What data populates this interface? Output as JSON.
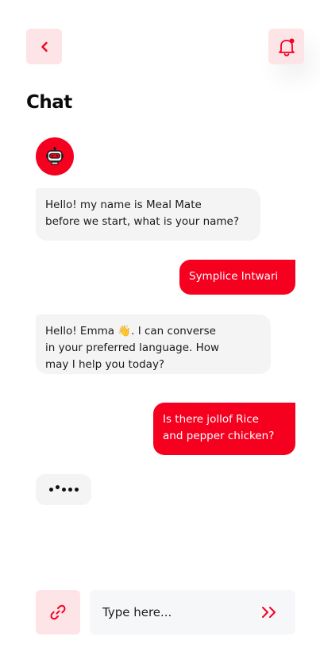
{
  "header": {
    "back_icon": "chevron-left-icon",
    "notification_icon": "bell-icon"
  },
  "page_title": "Chat",
  "bot_avatar_icon": "robot-icon",
  "messages": [
    {
      "sender": "bot",
      "lines": [
        "Hello! my name is Meal Mate",
        "before we start, what is your name?"
      ]
    },
    {
      "sender": "user",
      "lines": [
        "Symplice Intwari"
      ]
    },
    {
      "sender": "bot",
      "lines": [
        "Hello! Emma 👋. I can converse",
        "in your preferred language. How",
        "may I help you today?"
      ]
    },
    {
      "sender": "user",
      "lines": [
        "Is there jollof Rice",
        "and pepper chicken?"
      ]
    }
  ],
  "composer": {
    "placeholder": "Type here...",
    "attach_icon": "link-icon",
    "send_icon": "double-chevron-right-icon"
  },
  "colors": {
    "accent": "#f5001f",
    "accent_soft": "#fde4e6",
    "bubble_bot": "#f4f4f4",
    "input_bg": "#f6f7f9"
  }
}
